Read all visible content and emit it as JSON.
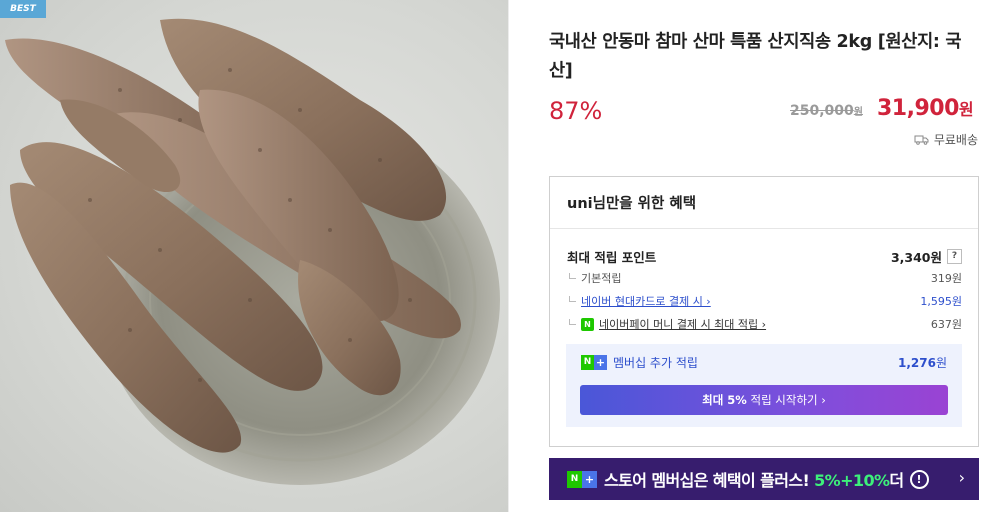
{
  "product": {
    "badge": "BEST",
    "title": "국내산 안동마 참마 산마 특품 산지직송 2kg [원산지: 국산]",
    "discount": "87%",
    "original_price": "250,000",
    "original_price_unit": "원",
    "sale_price": "31,900",
    "sale_price_unit": "원",
    "shipping": "무료배송",
    "image_icon": "yam-basket-photo"
  },
  "benefits": {
    "heading": "uni님만을 위한 혜택",
    "max_points_label": "최대 적립 포인트",
    "max_points_value": "3,340원",
    "help_label": "?",
    "rows": [
      {
        "label": "기본적립",
        "value": "319원"
      },
      {
        "label": "네이버 현대카드로 결제 시 ›",
        "value": "1,595원"
      },
      {
        "label": "네이버페이 머니 결제 시 최대 적립 ›",
        "value": "637원"
      }
    ],
    "member": {
      "label": "멤버십 추가 적립",
      "value": "1,276",
      "unit": "원",
      "button_strong": "최대 5%",
      "button_rest": " 적립 시작하기 ›"
    }
  },
  "banner": {
    "text_main": "스토어 멤버십은 혜택이 플러스! ",
    "text_green": "5%+10%",
    "text_tail": "더",
    "excl": "!",
    "chevron": "›"
  },
  "icons": {
    "n_badge": "N",
    "plus_badge": "+",
    "npay_badge": "N"
  },
  "colors": {
    "accent_red": "#d0233b",
    "member_blue": "#2d4fcc",
    "naver_green": "#1ec800",
    "banner_bg": "#371d6e"
  }
}
